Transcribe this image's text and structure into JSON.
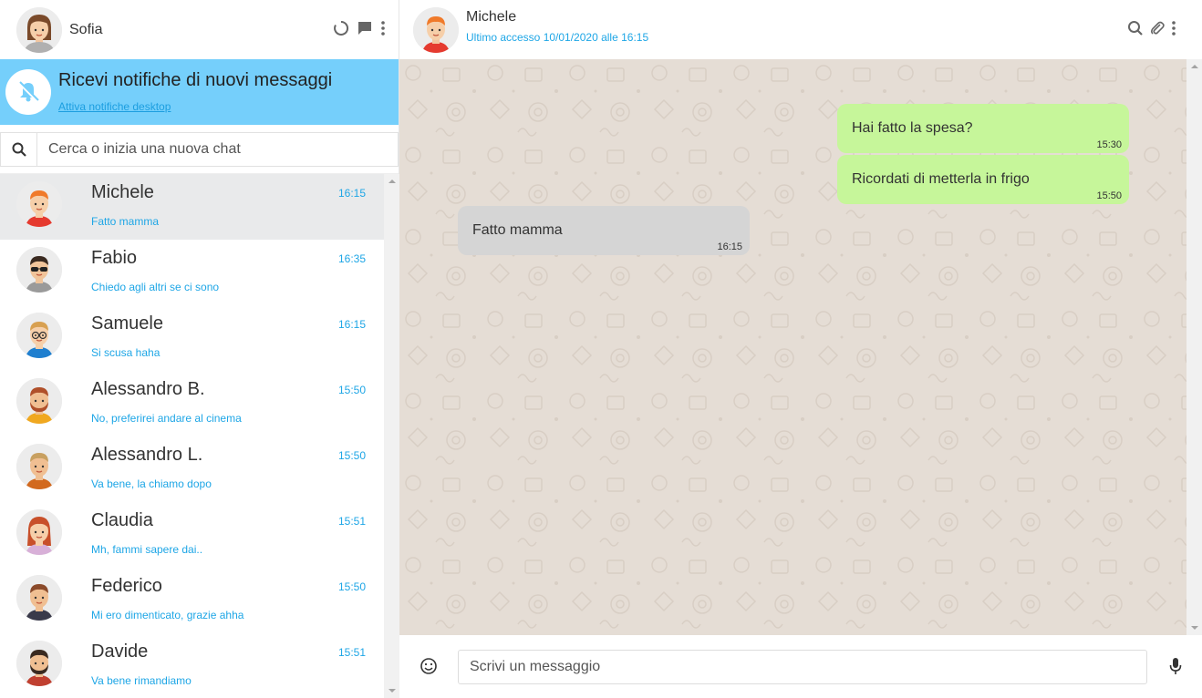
{
  "me": {
    "name": "Sofia"
  },
  "notification": {
    "title": "Ricevi notifiche di nuovi messaggi",
    "link": "Attiva notifiche desktop"
  },
  "search": {
    "placeholder": "Cerca o inizia una nuova chat"
  },
  "chats": [
    {
      "name": "Michele",
      "last": "Fatto mamma",
      "time": "16:15",
      "active": true
    },
    {
      "name": "Fabio",
      "last": "Chiedo agli altri se ci sono",
      "time": "16:35"
    },
    {
      "name": "Samuele",
      "last": "Si scusa haha",
      "time": "16:15"
    },
    {
      "name": "Alessandro B.",
      "last": "No, preferirei andare al cinema",
      "time": "15:50"
    },
    {
      "name": "Alessandro L.",
      "last": "Va bene, la chiamo dopo",
      "time": "15:50"
    },
    {
      "name": "Claudia",
      "last": "Mh, fammi sapere dai..",
      "time": "15:51"
    },
    {
      "name": "Federico",
      "last": "Mi ero dimenticato, grazie ahha",
      "time": "15:50"
    },
    {
      "name": "Davide",
      "last": "Va bene rimandiamo",
      "time": "15:51"
    }
  ],
  "contact": {
    "name": "Michele",
    "status": "Ultimo accesso 10/01/2020 alle 16:15"
  },
  "messages": [
    {
      "text": "Hai fatto la spesa?",
      "time": "15:30",
      "type": "sent"
    },
    {
      "text": "Ricordati di metterla in frigo",
      "time": "15:50",
      "type": "sent"
    },
    {
      "text": "Fatto mamma",
      "time": "16:15",
      "type": "recv"
    }
  ],
  "compose": {
    "placeholder": "Scrivi un messaggio"
  },
  "colors": {
    "accent": "#1ea6e6",
    "notification_bg": "#75cffb",
    "sent_bubble": "#c6f69a",
    "recv_bubble": "#d5d5d5",
    "chat_bg": "#e5ddd5"
  },
  "icons": {
    "header": [
      "status-icon",
      "chat-icon",
      "menu-dots-icon"
    ],
    "notification": "bell-off-icon",
    "search": "search-icon",
    "chat_header": [
      "search-icon",
      "paperclip-icon",
      "menu-dots-icon"
    ],
    "compose": [
      "emoji-icon",
      "microphone-icon"
    ]
  }
}
